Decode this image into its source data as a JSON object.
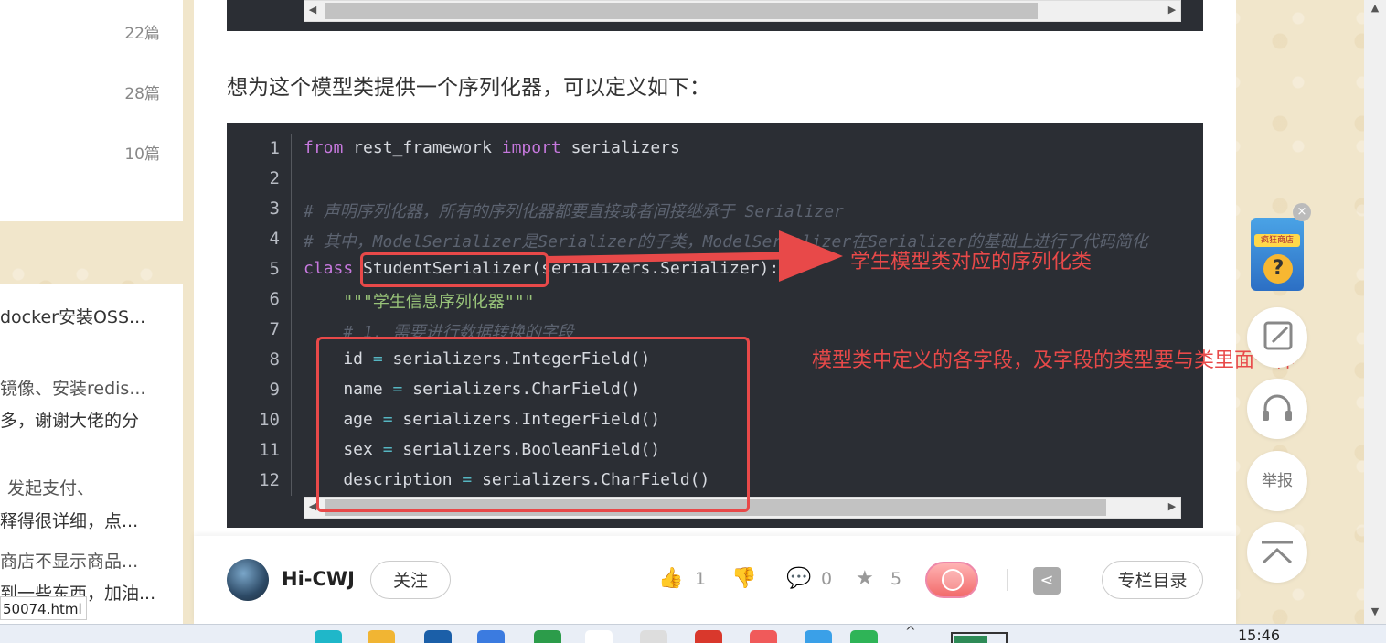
{
  "sidebar_top": {
    "counts": [
      "22篇",
      "28篇",
      "10篇"
    ]
  },
  "sidebar_bottom": {
    "lines": [
      "docker安装OSS...",
      "镜像、安装redis...",
      "多，谢谢大佬的分",
      "发起支付、",
      "释得很详细，点...",
      "商店不显示商品...",
      "到一些东西，加油..."
    ],
    "status_url": "50074.html"
  },
  "article": {
    "paragraph": "想为这个模型类提供一个序列化器，可以定义如下："
  },
  "code": {
    "line_numbers": [
      "1",
      "2",
      "3",
      "4",
      "5",
      "6",
      "7",
      "8",
      "9",
      "10",
      "11",
      "12"
    ],
    "lines": [
      {
        "type": "import",
        "kw1": "from",
        "mod": " rest_framework ",
        "kw2": "import",
        "name": " serializers"
      },
      {
        "type": "blank"
      },
      {
        "type": "comment",
        "text": "# 声明序列化器，所有的序列化器都要直接或者间接继承于 Serializer"
      },
      {
        "type": "comment",
        "text": "# 其中，ModelSerializer是Serializer的子类，ModelSerializer在Serializer的基础上进行了代码简化"
      },
      {
        "type": "class",
        "kw": "class",
        "name": "StudentSerializer",
        "rest": "(serializers.Serializer):"
      },
      {
        "type": "string",
        "text": "    \"\"\"学生信息序列化器\"\"\""
      },
      {
        "type": "comment",
        "text": "    # 1. 需要进行数据转换的字段"
      },
      {
        "type": "field",
        "name": "    id",
        "rhs": " serializers.IntegerField()"
      },
      {
        "type": "field",
        "name": "    name",
        "rhs": " serializers.CharField()"
      },
      {
        "type": "field",
        "name": "    age",
        "rhs": " serializers.IntegerField()"
      },
      {
        "type": "field",
        "name": "    sex",
        "rhs": " serializers.BooleanField()"
      },
      {
        "type": "field",
        "name": "    description",
        "rhs": " serializers.CharField()"
      }
    ]
  },
  "annotations": {
    "class_note": "学生模型类对应的序列化类",
    "fields_note": "模型类中定义的各字段，及字段的类型要与类里面一样"
  },
  "footer": {
    "author": "Hi-CWJ",
    "follow_label": "关注",
    "like_count": "1",
    "comment_count": "0",
    "star_count": "5",
    "toc_label": "专栏目录"
  },
  "float_toolbar": {
    "report_label": "举报",
    "promo_label": "疯狂商店"
  },
  "taskbar": {
    "time": "15:46"
  },
  "colors": {
    "code_bg": "#2b2e34",
    "annotation_red": "#e84949",
    "keyword": "#c678dd",
    "comment": "#5c6370",
    "string": "#98c379"
  }
}
